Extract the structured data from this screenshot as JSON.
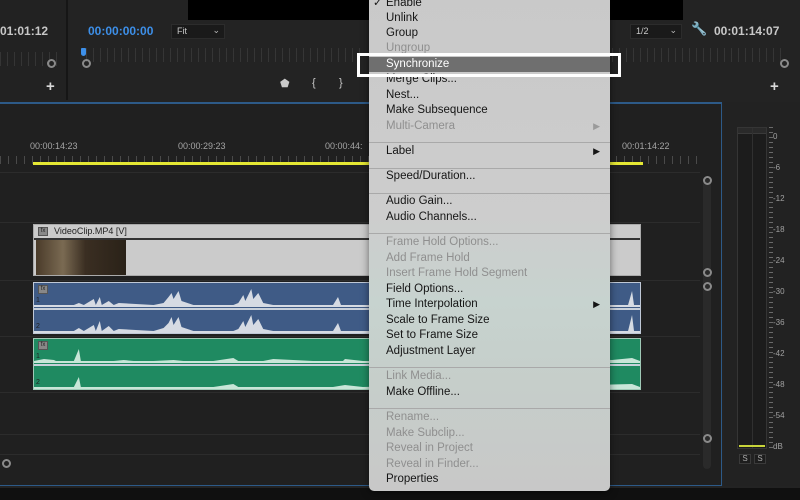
{
  "source_monitor": {
    "timecode": "01:01:12",
    "add_label": "+"
  },
  "program_monitor": {
    "current_timecode": "00:00:00:00",
    "zoom_select": "Fit",
    "resolution_select": "1/2",
    "duration_timecode": "00:01:14:07",
    "add_label": "+",
    "icons": {
      "marker": "marker-icon",
      "mark_in": "mark-in-icon",
      "mark_out": "mark-out-icon",
      "settings": "wrench-icon"
    }
  },
  "timeline": {
    "ruler_labels": [
      "00:00:14:23",
      "00:00:29:23",
      "00:00:44:",
      "00:01:14:22"
    ],
    "clips": {
      "video": {
        "name": "VideoClip.MP4 [V]",
        "fx": "fx"
      },
      "audio1": {
        "fx": "fx",
        "channels": [
          "1",
          "2"
        ],
        "color": "#3f5b86"
      },
      "audio2": {
        "fx": "fx",
        "channels": [
          "1",
          "2"
        ],
        "color": "#1f8a61"
      }
    },
    "work_area_color": "#e5e834"
  },
  "audio_meter": {
    "scale": [
      "0",
      "-6",
      "-12",
      "-18",
      "-24",
      "-30",
      "-36",
      "-42",
      "-48",
      "-54",
      "dB"
    ],
    "solo_buttons": [
      "S",
      "S"
    ]
  },
  "context_menu": {
    "items": [
      {
        "label": "Enable",
        "checked": true,
        "disabled": false
      },
      {
        "label": "Unlink",
        "disabled": false
      },
      {
        "label": "Group",
        "disabled": false
      },
      {
        "label": "Ungroup",
        "disabled": true
      },
      {
        "label": "Synchronize",
        "disabled": false,
        "highlighted": true
      },
      {
        "label": "Merge Clips...",
        "disabled": false
      },
      {
        "label": "Nest...",
        "disabled": false
      },
      {
        "label": "Make Subsequence",
        "disabled": false
      },
      {
        "label": "Multi-Camera",
        "disabled": true,
        "submenu": true
      },
      {
        "label": "Label",
        "disabled": false,
        "submenu": true
      },
      {
        "label": "Speed/Duration...",
        "disabled": false
      },
      {
        "label": "Audio Gain...",
        "disabled": false
      },
      {
        "label": "Audio Channels...",
        "disabled": false
      },
      {
        "label": "Frame Hold Options...",
        "disabled": true
      },
      {
        "label": "Add Frame Hold",
        "disabled": true
      },
      {
        "label": "Insert Frame Hold Segment",
        "disabled": true
      },
      {
        "label": "Field Options...",
        "disabled": false
      },
      {
        "label": "Time Interpolation",
        "disabled": false,
        "submenu": true
      },
      {
        "label": "Scale to Frame Size",
        "disabled": false
      },
      {
        "label": "Set to Frame Size",
        "disabled": false
      },
      {
        "label": "Adjustment Layer",
        "disabled": false
      },
      {
        "label": "Link Media...",
        "disabled": true
      },
      {
        "label": "Make Offline...",
        "disabled": false
      },
      {
        "label": "Rename...",
        "disabled": true
      },
      {
        "label": "Make Subclip...",
        "disabled": true
      },
      {
        "label": "Reveal in Project",
        "disabled": true
      },
      {
        "label": "Reveal in Finder...",
        "disabled": true
      },
      {
        "label": "Properties",
        "disabled": false
      }
    ],
    "check_glyph": "✓",
    "submenu_glyph": "▶"
  }
}
